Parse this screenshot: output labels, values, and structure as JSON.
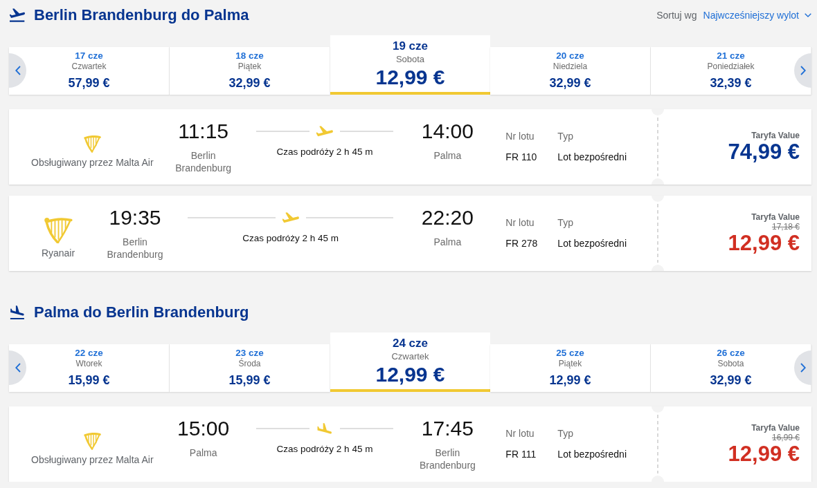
{
  "sections": [
    {
      "kind": "departure",
      "title": "Berlin Brandenburg do Palma",
      "sort": {
        "label": "Sortuj wg",
        "value": "Najwcześniejszy wylot"
      },
      "dates": [
        {
          "date": "17 cze",
          "weekday": "Czwartek",
          "price": "57,99 €",
          "selected": false
        },
        {
          "date": "18 cze",
          "weekday": "Piątek",
          "price": "32,99 €",
          "selected": false
        },
        {
          "date": "19 cze",
          "weekday": "Sobota",
          "price": "12,99 €",
          "selected": true
        },
        {
          "date": "20 cze",
          "weekday": "Niedziela",
          "price": "32,99 €",
          "selected": false
        },
        {
          "date": "21 cze",
          "weekday": "Poniedziałek",
          "price": "32,39 €",
          "selected": false
        }
      ],
      "flights": [
        {
          "kind": "partner",
          "operator": "Obsługiwany przez Malta Air",
          "departure_time": "11:15",
          "departure_airport": "Berlin Brandenburg",
          "duration": "Czas podróży 2 h 45 m",
          "arrival_time": "14:00",
          "arrival_airport": "Palma",
          "flight_number_label": "Nr lotu",
          "flight_number": "FR 110",
          "type_label": "Typ",
          "type": "Lot bezpośredni",
          "fare_label": "Taryfa Value",
          "price": "74,99 €",
          "discounted": false
        },
        {
          "kind": "own",
          "operator": "Ryanair",
          "departure_time": "19:35",
          "departure_airport": "Berlin Brandenburg",
          "duration": "Czas podróży 2 h 45 m",
          "arrival_time": "22:20",
          "arrival_airport": "Palma",
          "flight_number_label": "Nr lotu",
          "flight_number": "FR 278",
          "type_label": "Typ",
          "type": "Lot bezpośredni",
          "fare_label": "Taryfa Value",
          "old_price": "17,18 €",
          "price": "12,99 €",
          "discounted": true
        }
      ]
    },
    {
      "kind": "arrival",
      "title": "Palma do Berlin Brandenburg",
      "dates": [
        {
          "date": "22 cze",
          "weekday": "Wtorek",
          "price": "15,99 €",
          "selected": false
        },
        {
          "date": "23 cze",
          "weekday": "Środa",
          "price": "15,99 €",
          "selected": false
        },
        {
          "date": "24 cze",
          "weekday": "Czwartek",
          "price": "12,99 €",
          "selected": true
        },
        {
          "date": "25 cze",
          "weekday": "Piątek",
          "price": "12,99 €",
          "selected": false
        },
        {
          "date": "26 cze",
          "weekday": "Sobota",
          "price": "32,99 €",
          "selected": false
        }
      ],
      "flights": [
        {
          "kind": "partner",
          "operator": "Obsługiwany przez Malta Air",
          "departure_time": "15:00",
          "departure_airport": "Palma",
          "duration": "Czas podróży 2 h 45 m",
          "arrival_time": "17:45",
          "arrival_airport": "Berlin Brandenburg",
          "flight_number_label": "Nr lotu",
          "flight_number": "FR 111",
          "type_label": "Typ",
          "type": "Lot bezpośredni",
          "fare_label": "Taryfa Value",
          "old_price": "16,99 €",
          "price": "12,99 €",
          "discounted": true
        }
      ]
    }
  ]
}
